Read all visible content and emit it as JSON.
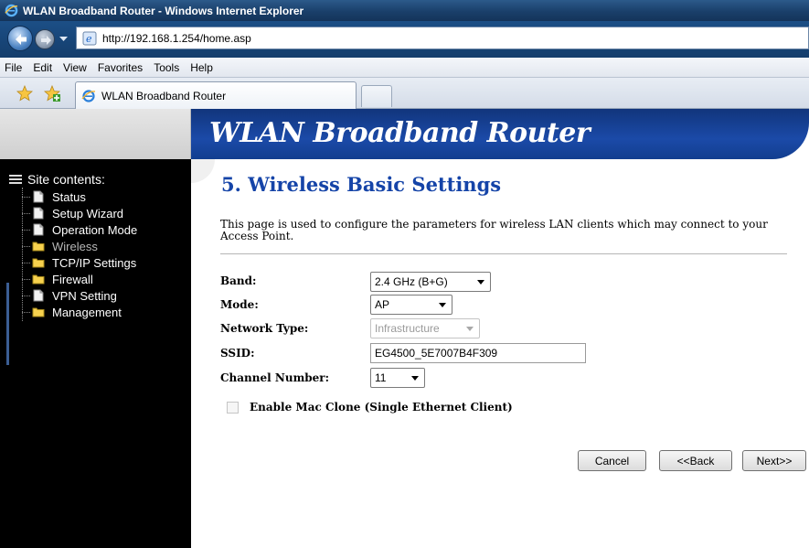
{
  "window": {
    "title": "WLAN Broadband Router - Windows Internet Explorer"
  },
  "address": {
    "url": "http://192.168.1.254/home.asp"
  },
  "menu": {
    "items": [
      "File",
      "Edit",
      "View",
      "Favorites",
      "Tools",
      "Help"
    ]
  },
  "tab": {
    "title": "WLAN Broadband Router"
  },
  "banner": {
    "title": "WLAN Broadband Router"
  },
  "sidebar": {
    "heading": "Site contents:",
    "items": [
      {
        "label": "Status",
        "icon": "page-icon"
      },
      {
        "label": "Setup Wizard",
        "icon": "page-icon"
      },
      {
        "label": "Operation Mode",
        "icon": "page-icon"
      },
      {
        "label": "Wireless",
        "icon": "folder-icon",
        "active": true
      },
      {
        "label": "TCP/IP Settings",
        "icon": "folder-icon"
      },
      {
        "label": "Firewall",
        "icon": "folder-icon"
      },
      {
        "label": "VPN Setting",
        "icon": "page-icon"
      },
      {
        "label": "Management",
        "icon": "folder-icon"
      }
    ]
  },
  "content": {
    "title": "5. Wireless Basic Settings",
    "description": "This page is used to configure the parameters for wireless LAN clients which may connect to your Access Point.",
    "fields": {
      "band": {
        "label": "Band:",
        "value": "2.4 GHz (B+G)"
      },
      "mode": {
        "label": "Mode:",
        "value": "AP"
      },
      "network_type": {
        "label": "Network Type:",
        "value": "Infrastructure",
        "disabled": true
      },
      "ssid": {
        "label": "SSID:",
        "value": "EG4500_5E7007B4F309"
      },
      "channel": {
        "label": "Channel Number:",
        "value": "11"
      }
    },
    "mac_clone": {
      "label": "Enable Mac Clone (Single Ethernet Client)",
      "checked": false
    },
    "buttons": {
      "cancel": "Cancel",
      "back": "<<Back",
      "next": "Next>>"
    }
  },
  "colors": {
    "banner": "#1b4aa8",
    "title_text": "#1544a8",
    "sidebar_bg": "#000000"
  }
}
